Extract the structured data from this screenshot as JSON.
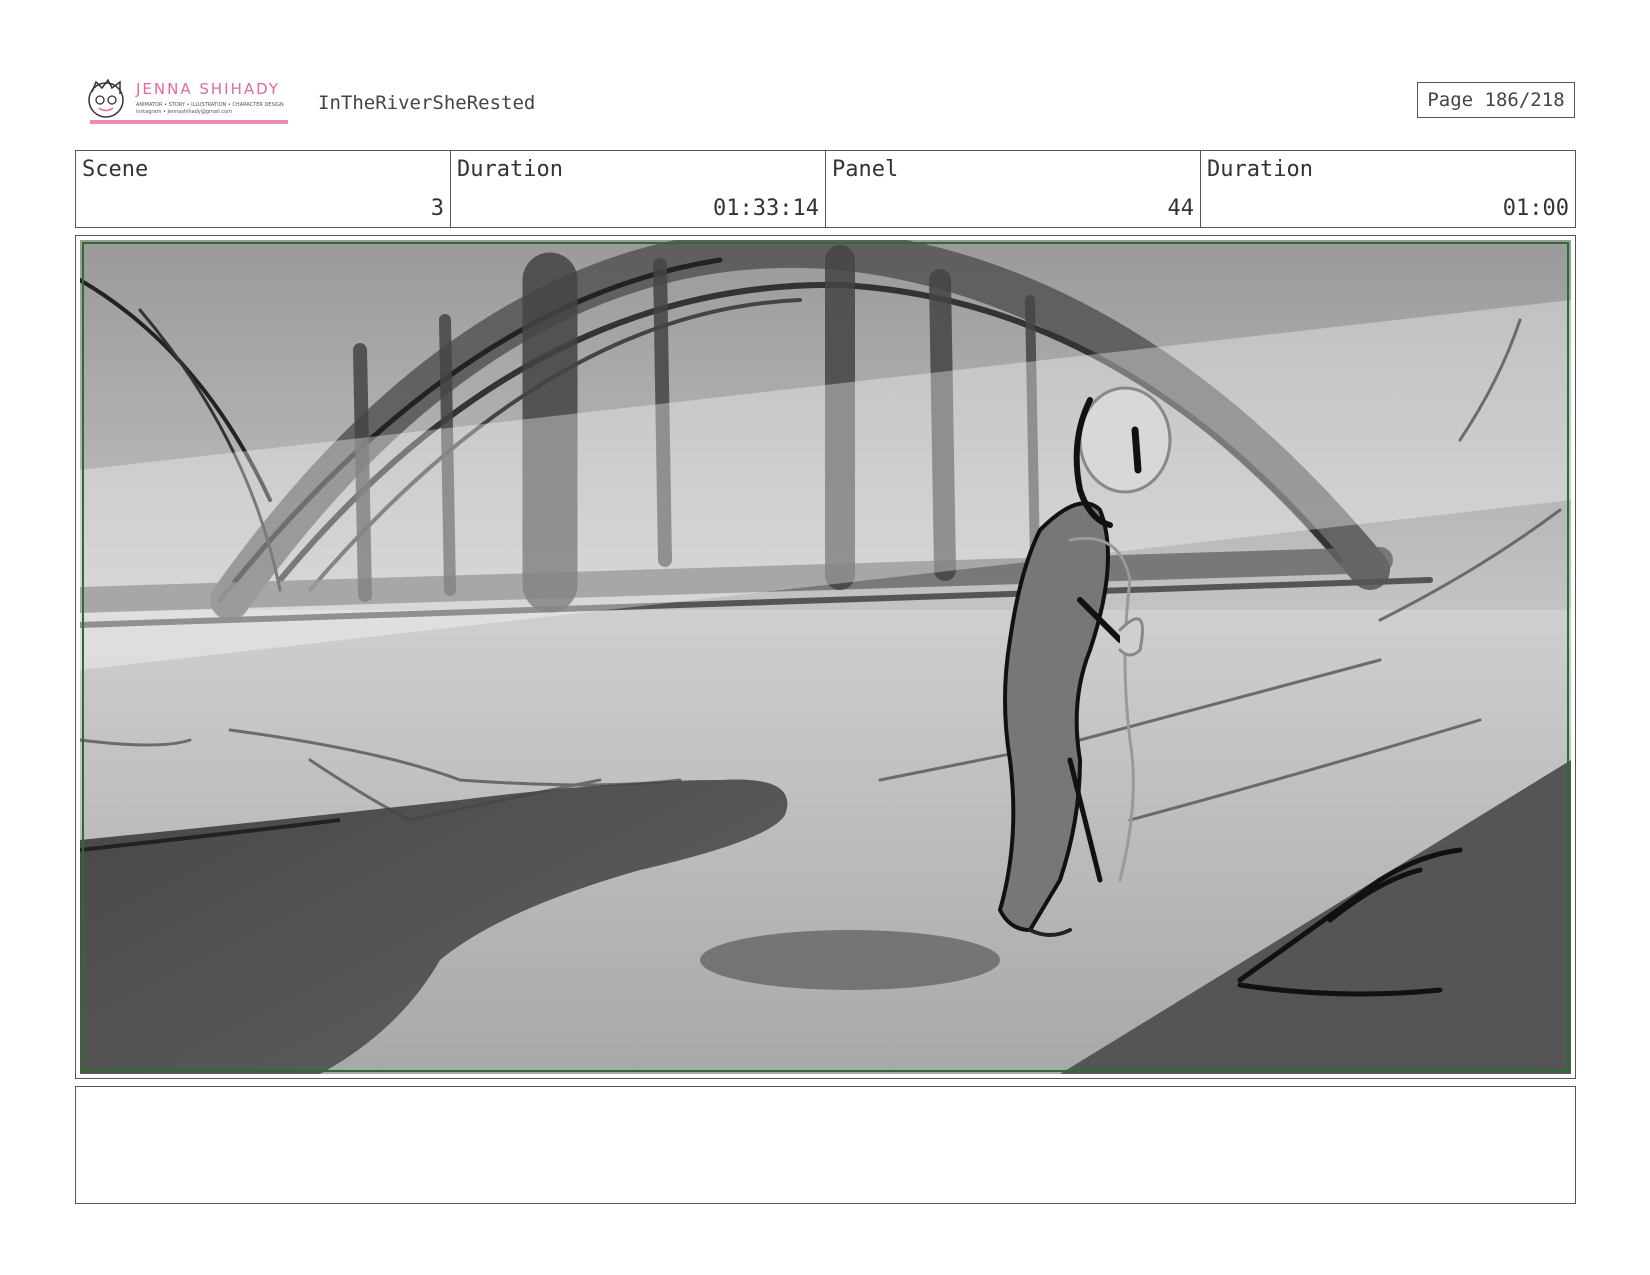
{
  "header": {
    "logo": {
      "name": "JENNA SHIHADY",
      "tagline": "ANIMATOR • STORY • ILLUSTRATION • CHARACTER DESIGN",
      "contact": "instagram • jennashihady@gmail.com",
      "accent_color": "#e36a9c"
    },
    "project_title": "InTheRiverSheRested",
    "page_label": "Page 186/218"
  },
  "info": {
    "scene_label": "Scene",
    "scene_value": "3",
    "scene_duration_label": "Duration",
    "scene_duration_value": "01:33:14",
    "panel_label": "Panel",
    "panel_value": "44",
    "panel_duration_label": "Duration",
    "panel_duration_value": "01:00"
  },
  "panel_image": {
    "safe_area_color": "#2e6b2e"
  },
  "notes": {
    "text": ""
  }
}
